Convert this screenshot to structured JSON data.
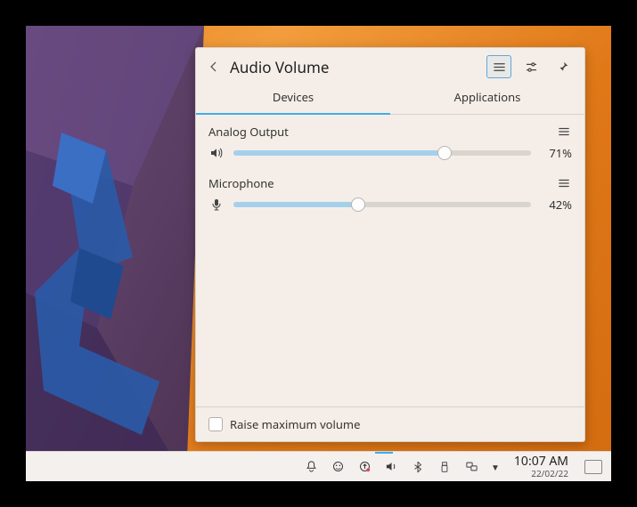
{
  "popup": {
    "title": "Audio Volume",
    "tabs": {
      "devices": "Devices",
      "applications": "Applications",
      "active": "devices"
    },
    "devices": [
      {
        "name": "Analog Output",
        "percent": "71%",
        "value": 71,
        "icon": "speaker"
      },
      {
        "name": "Microphone",
        "percent": "42%",
        "value": 42,
        "icon": "microphone"
      }
    ],
    "raise": {
      "label": "Raise maximum volume",
      "checked": false
    }
  },
  "panel": {
    "clock": {
      "time": "10:07 AM",
      "date": "22/02/22"
    }
  }
}
